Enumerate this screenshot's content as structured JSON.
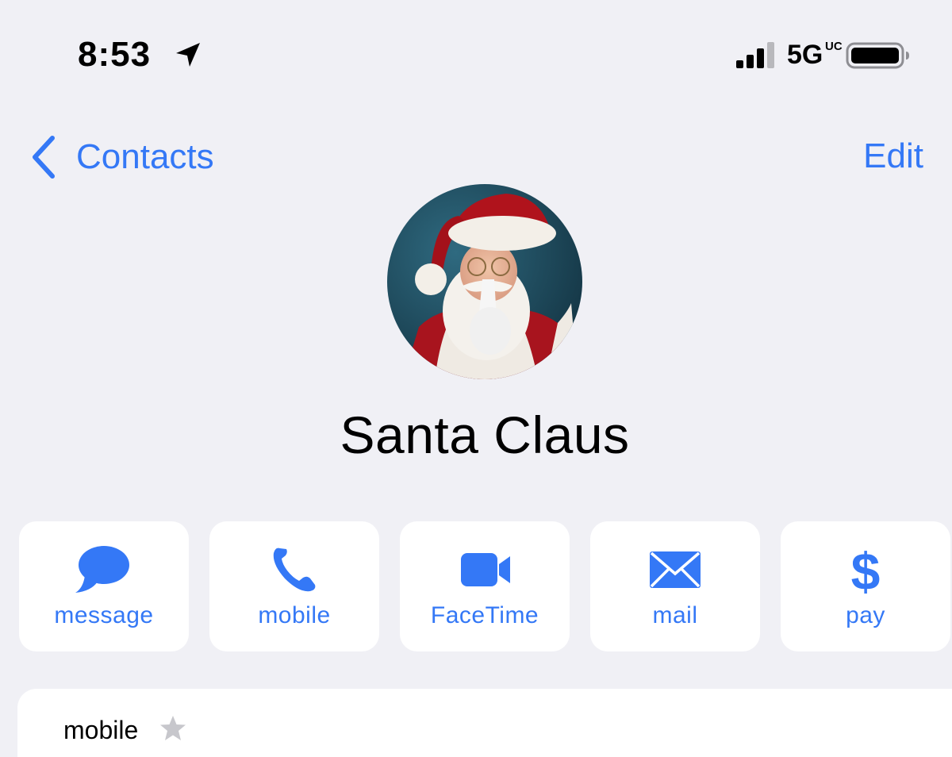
{
  "status_bar": {
    "time": "8:53",
    "location_icon": "location-arrow-icon",
    "signal_icon": "cellular-signal-icon",
    "network": "5G",
    "network_superscript": "UC",
    "battery_icon": "battery-full-icon"
  },
  "nav": {
    "back_icon": "chevron-left-icon",
    "back_label": "Contacts",
    "edit_label": "Edit"
  },
  "contact": {
    "name": "Santa Claus",
    "avatar_icon": "contact-photo-avatar"
  },
  "actions": [
    {
      "label": "message",
      "icon": "message-bubble-icon"
    },
    {
      "label": "mobile",
      "icon": "phone-icon"
    },
    {
      "label": "FaceTime",
      "icon": "video-camera-icon"
    },
    {
      "label": "mail",
      "icon": "envelope-icon"
    },
    {
      "label": "pay",
      "icon": "dollar-icon"
    }
  ],
  "phone_card": {
    "label": "mobile",
    "star_icon": "star-icon"
  },
  "colors": {
    "accent": "#3478f6",
    "background": "#f0f0f5",
    "card": "#ffffff",
    "star": "#c7c7cc"
  }
}
